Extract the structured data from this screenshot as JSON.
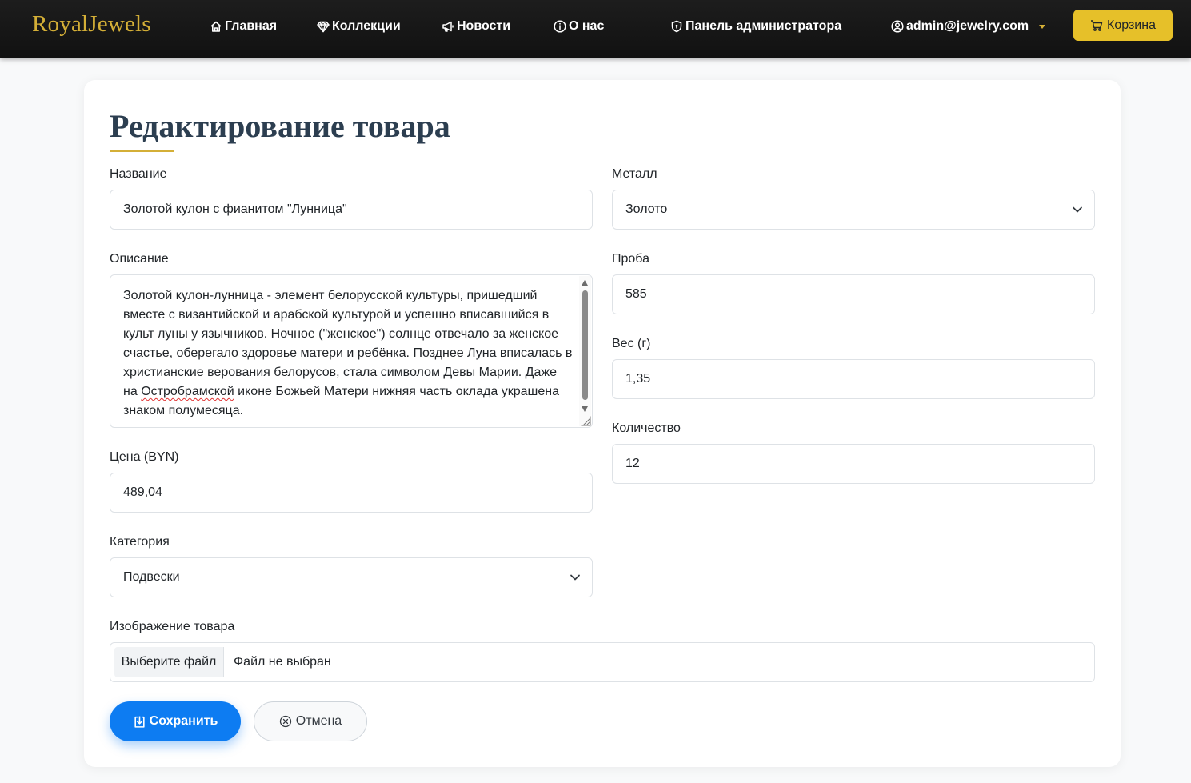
{
  "navbar": {
    "brand": "RoyalJewels",
    "links": [
      {
        "label": "Главная",
        "icon": "house-icon"
      },
      {
        "label": "Коллекции",
        "icon": "gem-icon"
      },
      {
        "label": "Новости",
        "icon": "megaphone-icon"
      },
      {
        "label": "О нас",
        "icon": "info-circle-icon"
      },
      {
        "label": "Панель администратора",
        "icon": "shield-icon"
      }
    ],
    "user": {
      "email": "admin@jewelry.com",
      "icon": "person-circle-icon"
    },
    "cart": {
      "label": "Корзина",
      "icon": "cart-icon"
    }
  },
  "form": {
    "title": "Редактирование товара",
    "name": {
      "label": "Название",
      "value": "Золотой кулон с фианитом \"Лунница\""
    },
    "description": {
      "label": "Описание",
      "value_lines": [
        "Золотой кулон-лунница - элемент белорусской культуры, пришедший",
        "вместе с византийской и арабской культурой и успешно вписавшийся в",
        "культ луны у язычников. Ночное (\"женское\") солнце отвечало за женское",
        "счастье, оберегало здоровье матери и ребёнка. Позднее Луна вписалась в",
        "христианские верования белорусов, стала символом Девы Марии. Даже"
      ],
      "line6_before": "на ",
      "line6_misspelled": "Остробрамской",
      "line6_after": " иконе Божьей Матери нижняя часть оклада украшена",
      "line7": "знаком полумесяца."
    },
    "price": {
      "label": "Цена (BYN)",
      "value": "489,04"
    },
    "category": {
      "label": "Категория",
      "value": "Подвески"
    },
    "metal": {
      "label": "Металл",
      "value": "Золото"
    },
    "fineness": {
      "label": "Проба",
      "value": "585"
    },
    "weight": {
      "label": "Вес (г)",
      "value": "1,35"
    },
    "quantity": {
      "label": "Количество",
      "value": "12"
    },
    "image": {
      "label": "Изображение товара",
      "button": "Выберите файл",
      "status": "Файл не выбран"
    },
    "save_label": "Сохранить",
    "cancel_label": "Отмена"
  },
  "colors": {
    "accent_gold": "#d4af37",
    "cart_button": "#e6c029",
    "primary_blue": "#0d7cf2",
    "title_color": "#2c3e50",
    "navbar_bg": "#151515"
  }
}
